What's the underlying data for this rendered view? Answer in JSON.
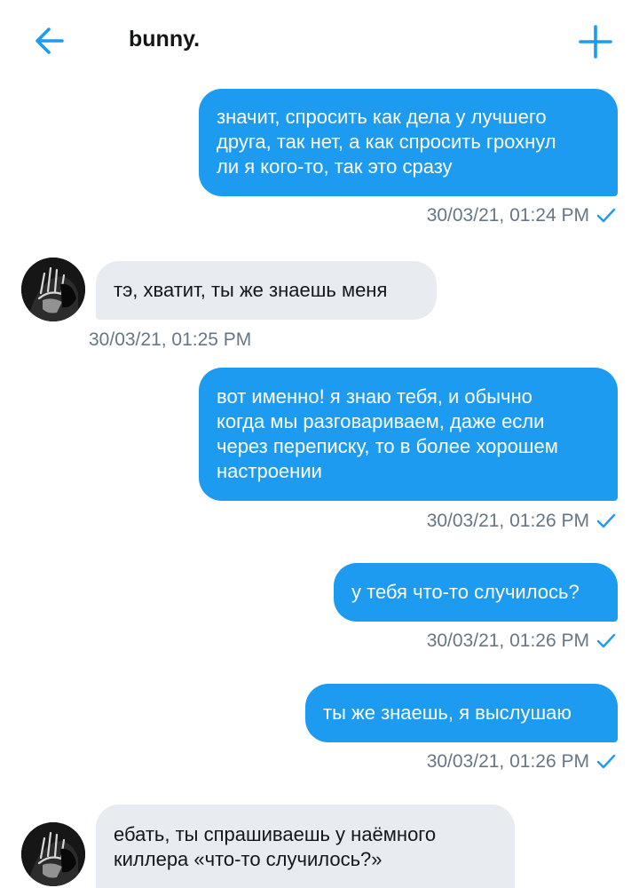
{
  "header": {
    "title": "bunny."
  },
  "messages": [
    {
      "text": "значит, спросить как дела у лучшего\nдруга, так нет, а как спросить грохнул\nли я кого-то, так это сразу",
      "time": "30/03/21, 01:24 PM"
    },
    {
      "text": "тэ, хватит, ты же знаешь меня",
      "time": "30/03/21, 01:25 PM"
    },
    {
      "text": "вот именно! я знаю тебя, и обычно\nкогда мы разговариваем, даже если\nчерез переписку, то в более хорошем\nнастроении",
      "time": "30/03/21, 01:26 PM"
    },
    {
      "text": "у тебя что-то случилось?",
      "time": "30/03/21, 01:26 PM"
    },
    {
      "text": "ты же знаешь, я выслушаю",
      "time": "30/03/21, 01:26 PM"
    },
    {
      "text": "ебать, ты спрашиваешь у наёмного\nкиллера «что-то случилось?»"
    }
  ],
  "colors": {
    "accent": "#1d9bf0",
    "incoming_bg": "#e8ecf1",
    "meta": "#657786"
  },
  "icons": {
    "back": "arrow-left-icon",
    "new": "plus-icon",
    "read": "checkmark-icon"
  }
}
